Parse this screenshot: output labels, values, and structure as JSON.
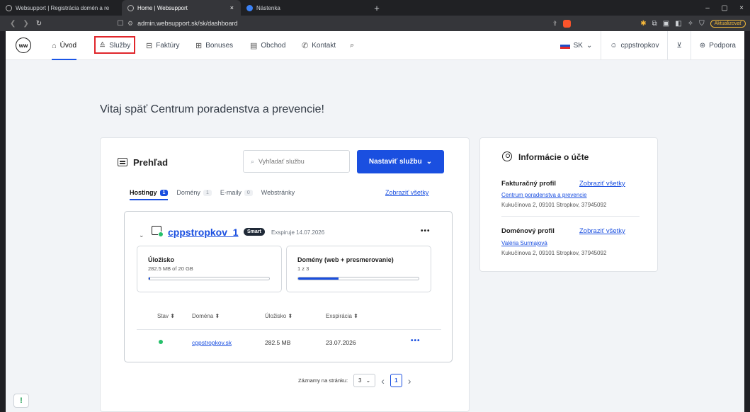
{
  "browser": {
    "tabs": [
      {
        "title": "Websupport | Registrácia domén a re"
      },
      {
        "title": "Home | Websupport",
        "close": "×"
      },
      {
        "title": "Nástenka"
      }
    ],
    "new_tab": "+",
    "window_controls": [
      "–",
      "▢",
      "×"
    ],
    "url": "admin.websupport.sk/sk/dashboard",
    "update_label": "Aktualizovať"
  },
  "nav": {
    "logo": "ww",
    "items": [
      {
        "label": "Úvod",
        "icon": "home-icon",
        "glyph": "⌂"
      },
      {
        "label": "Služby",
        "icon": "layers-icon",
        "glyph": "≙"
      },
      {
        "label": "Faktúry",
        "icon": "invoice-icon",
        "glyph": "⊟"
      },
      {
        "label": "Bonuses",
        "icon": "gift-icon",
        "glyph": "⊞"
      },
      {
        "label": "Obchod",
        "icon": "store-icon",
        "glyph": "▤"
      },
      {
        "label": "Kontakt",
        "icon": "phone-icon",
        "glyph": "✆"
      }
    ],
    "search_glyph": "⌕",
    "language": "SK",
    "username": "cppstropkov",
    "support": "Podpora"
  },
  "welcome": "Vitaj späť Centrum poradenstva a prevencie!",
  "overview": {
    "title": "Prehľad",
    "search_placeholder": "Vyhľadať službu",
    "setup_button": "Nastaviť službu",
    "tabs": [
      {
        "label": "Hostingy",
        "count": "1"
      },
      {
        "label": "Domény",
        "count": "1"
      },
      {
        "label": "E-maily",
        "count": "0"
      },
      {
        "label": "Webstránky",
        "count": ""
      }
    ],
    "show_all": "Zobraziť všetky",
    "hosting": {
      "name": "cppstropkov_1",
      "badge": "Smart",
      "expiry": "Exspiruje 14.07.2026",
      "storage": {
        "title": "Úložisko",
        "sub": "282.5 MB of 20 GB",
        "fraction": 0.014
      },
      "domains": {
        "title": "Domény (web + presmerovanie)",
        "sub": "1 z 3",
        "fraction": 0.333
      },
      "table": {
        "headers": [
          "Stav ⬍",
          "Doména ⬍",
          "Úložisko ⬍",
          "Exspirácia ⬍"
        ],
        "rows": [
          {
            "domain": "cppstropkov.sk",
            "storage": "282.5 MB",
            "expiry": "23.07.2026"
          }
        ]
      }
    },
    "pager": {
      "label": "Záznamy na stránku:",
      "per_page": "3",
      "page": "1"
    }
  },
  "account": {
    "title": "Informácie o účte",
    "billing_label": "Fakturačný profil",
    "billing_link": "Zobraziť všetky",
    "billing_name": "Centrum poradenstva a prevencie",
    "billing_addr": "Kukučínova 2, 09101 Stropkov, 37945092",
    "domain_label": "Doménový profil",
    "domain_link": "Zobraziť všetky",
    "domain_name": "Valéria Surmajová",
    "domain_addr": "Kukučínova 2, 09101 Stropkov, 37945092"
  },
  "colors": {
    "accent": "#1a4fe0",
    "highlight": "#e0262b",
    "success": "#25c06a"
  }
}
